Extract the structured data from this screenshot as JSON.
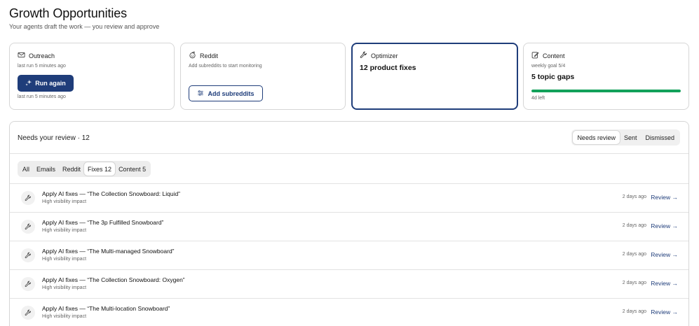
{
  "header": {
    "title": "Growth Opportunities",
    "subtitle": "Your agents draft the work — you review and approve"
  },
  "cards": {
    "outreach": {
      "title": "Outreach",
      "last_run_top": "last run 5 minutes ago",
      "button_label": "Run again",
      "last_run_bottom": "last run 5 minutes ago"
    },
    "reddit": {
      "title": "Reddit",
      "subtitle": "Add subreddits to start monitoring",
      "button_label": "Add subreddits"
    },
    "optimizer": {
      "title": "Optimizer",
      "summary": "12 product fixes"
    },
    "content": {
      "title": "Content",
      "goal": "weekly goal 5/4",
      "summary": "5 topic gaps",
      "progress_fraction": 1.0,
      "footer": "4d left"
    }
  },
  "review": {
    "title": "Needs your review · 12",
    "tabs": [
      "Needs review",
      "Sent",
      "Dismissed"
    ],
    "active_tab": "Needs review",
    "filters": [
      "All",
      "Emails",
      "Reddit",
      "Fixes 12",
      "Content 5"
    ],
    "active_filter": "Fixes 12",
    "items": [
      {
        "title": "Apply AI fixes — “The Collection Snowboard: Liquid”",
        "subtitle": "High visibility impact",
        "time": "2 days ago",
        "action": "Review →"
      },
      {
        "title": "Apply AI fixes — “The 3p Fulfilled Snowboard”",
        "subtitle": "High visibility impact",
        "time": "2 days ago",
        "action": "Review →"
      },
      {
        "title": "Apply AI fixes — “The Multi-managed Snowboard”",
        "subtitle": "High visibility impact",
        "time": "2 days ago",
        "action": "Review →"
      },
      {
        "title": "Apply AI fixes — “The Collection Snowboard: Oxygen”",
        "subtitle": "High visibility impact",
        "time": "2 days ago",
        "action": "Review →"
      },
      {
        "title": "Apply AI fixes — “The Multi-location Snowboard”",
        "subtitle": "High visibility impact",
        "time": "2 days ago",
        "action": "Review →"
      }
    ]
  },
  "colors": {
    "accent": "#1f3d7a",
    "progress": "#12a15a",
    "border": "#d6d6d6"
  },
  "icons": {
    "outreach": "mail-icon",
    "reddit": "reddit-icon",
    "optimizer": "wrench-icon",
    "content": "edit-icon",
    "run": "sparkles-icon",
    "add": "sliders-icon",
    "row": "wrench-icon"
  }
}
